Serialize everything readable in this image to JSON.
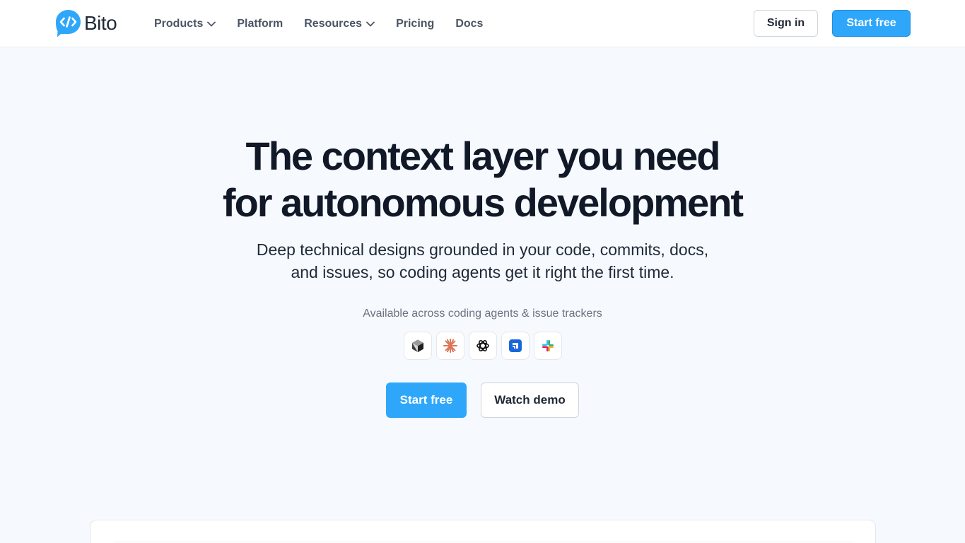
{
  "brand": {
    "name": "Bito",
    "accent": "#2ea7fb"
  },
  "nav": {
    "items": [
      {
        "label": "Products",
        "has_dropdown": true
      },
      {
        "label": "Platform",
        "has_dropdown": false
      },
      {
        "label": "Resources",
        "has_dropdown": true
      },
      {
        "label": "Pricing",
        "has_dropdown": false
      },
      {
        "label": "Docs",
        "has_dropdown": false
      }
    ]
  },
  "header": {
    "sign_in_label": "Sign in",
    "start_free_label": "Start free"
  },
  "hero": {
    "title_line_1": "The context layer you need",
    "title_line_2": "for autonomous development",
    "subtitle_line_1": "Deep technical designs grounded in your code, commits, docs,",
    "subtitle_line_2": "and issues, so coding agents get it right the first time.",
    "availability": "Available across coding agents & issue trackers",
    "integrations": [
      "cursor-icon",
      "claude-icon",
      "openai-icon",
      "jira-icon",
      "slack-icon"
    ],
    "primary_cta": "Start free",
    "secondary_cta": "Watch demo"
  }
}
